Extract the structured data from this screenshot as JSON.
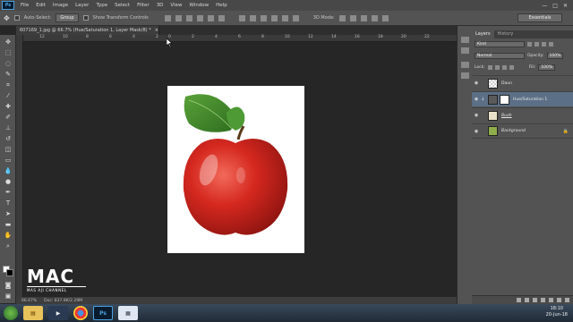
{
  "menubar": {
    "logo": "Ps",
    "items": [
      "File",
      "Edit",
      "Image",
      "Layer",
      "Type",
      "Select",
      "Filter",
      "3D",
      "View",
      "Window",
      "Help"
    ],
    "controls": [
      "—",
      "□",
      "✕"
    ]
  },
  "options": {
    "auto_select_label": "Auto-Select:",
    "group_value": "Group",
    "transform_label": "Show Transform Controls",
    "mode_label": "3D Mode:",
    "workspace": "Essentials"
  },
  "document": {
    "tab_title": "607169_1.jpg @ 66.7% (Hue/Saturation 1, Layer Mask/8) *",
    "tab_close": "×",
    "ruler_numbers": [
      "12",
      "10",
      "8",
      "6",
      "4",
      "2",
      "0",
      "2",
      "4",
      "6",
      "8",
      "10",
      "12",
      "14",
      "16",
      "18",
      "20",
      "22"
    ]
  },
  "status": {
    "zoom": "66.67%",
    "doc": "Doc: 837.8K/2.29M"
  },
  "panel": {
    "tabs": [
      "Layers",
      "History"
    ],
    "kind_label": "Kind",
    "blend_mode": "Normal",
    "opacity_label": "Opacity:",
    "opacity_value": "100%",
    "lock_label": "Lock:",
    "fill_label": "Fill:",
    "fill_value": "100%",
    "layers": [
      {
        "name": "Daun",
        "selected": false
      },
      {
        "name": "Hue/Saturation 1",
        "selected": true
      },
      {
        "name": "Buah",
        "selected": false
      },
      {
        "name": "Background",
        "selected": false
      }
    ]
  },
  "taskbar": {
    "time": "18:10",
    "date": "20-Jun-18",
    "apps": [
      "start",
      "explorer",
      "media",
      "chrome",
      "photoshop",
      "image-viewer"
    ]
  },
  "watermark": {
    "logo": "MAC",
    "subtitle": "MAS AJI CHANNEL"
  },
  "colors": {
    "apple_red": "#c8201c",
    "leaf_green": "#3f8a2a",
    "selected_layer": "#5b6f86",
    "ps_blue": "#4aa3e0"
  }
}
